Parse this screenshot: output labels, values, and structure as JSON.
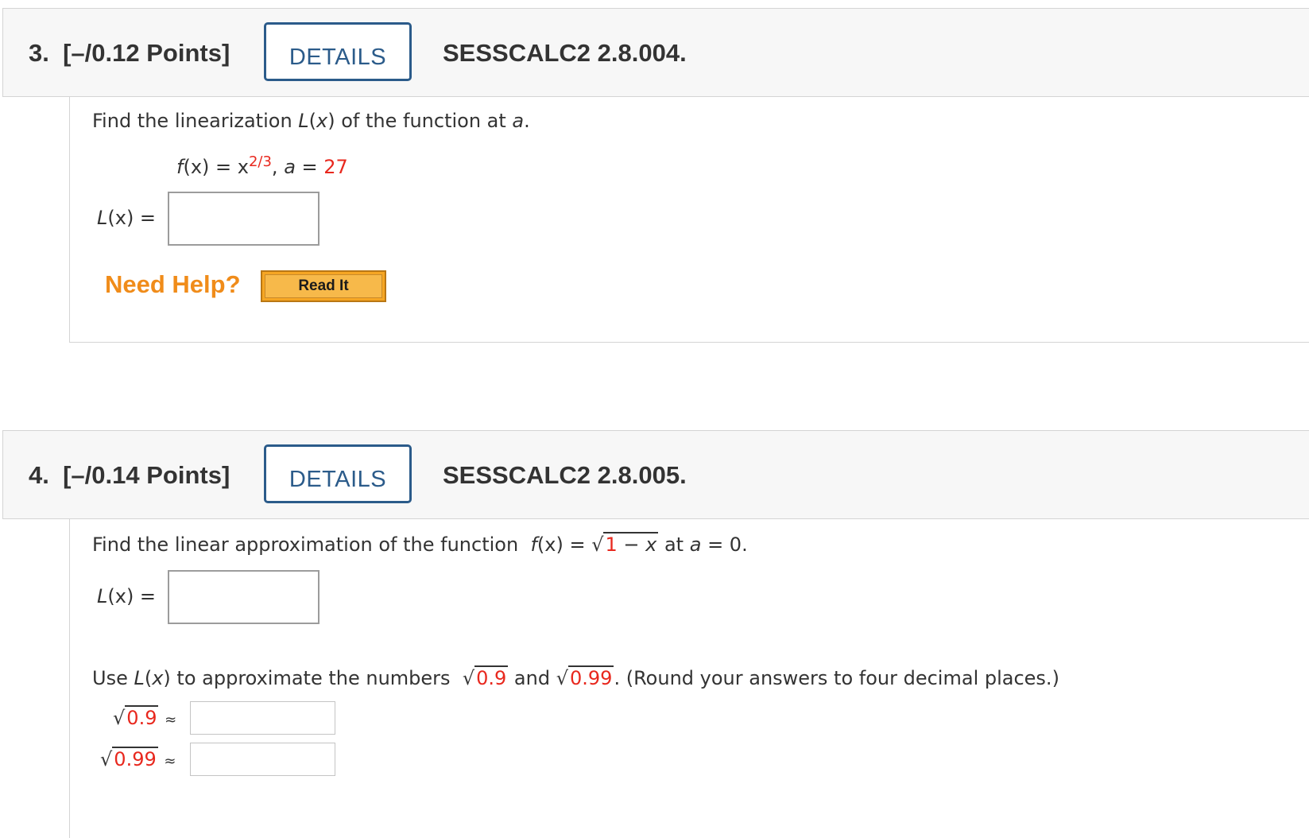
{
  "q3": {
    "number": "3.",
    "points": "[–/0.12 Points]",
    "details_label": "DETAILS",
    "ref": "SESSCALC2 2.8.004.",
    "prompt_a": "Find the linearization ",
    "prompt_Lx": "L",
    "prompt_b": "(",
    "prompt_x": "x",
    "prompt_c": ") of the function at ",
    "prompt_a_var": "a",
    "prompt_end": ".",
    "fx_f": "f",
    "fx_paren": "(x) = x",
    "fx_exp": "2/3",
    "fx_comma": ", ",
    "fx_a": "a",
    "fx_eq": " = ",
    "fx_aval": "27",
    "answer_label_L": "L",
    "answer_label_rest": "(x) =",
    "answer_value": "",
    "need_help": "Need Help?",
    "read_it": "Read It"
  },
  "q4": {
    "number": "4.",
    "points": "[–/0.14 Points]",
    "details_label": "DETAILS",
    "ref": "SESSCALC2 2.8.005.",
    "prompt_a": "Find the linear approximation of the function ",
    "fx_f": "f",
    "fx_paren": "(x) = ",
    "sqrt_one": "1",
    "sqrt_minus": " − ",
    "sqrt_x": "x",
    "prompt_at": " at ",
    "prompt_a_var": "a",
    "prompt_zero": " = 0.",
    "answer_label_L": "L",
    "answer_label_rest": "(x) =",
    "answer_value": "",
    "use_a": "Use ",
    "use_L": "L",
    "use_b": "(",
    "use_x": "x",
    "use_c": ") to approximate the numbers ",
    "num1": "0.9",
    "and": " and ",
    "num2": "0.99",
    "round_note": ". (Round your answers to four decimal places.)",
    "approx1_num": "0.9",
    "approx2_num": "0.99",
    "approx_sym": "≈",
    "approx1_value": "",
    "approx2_value": ""
  }
}
